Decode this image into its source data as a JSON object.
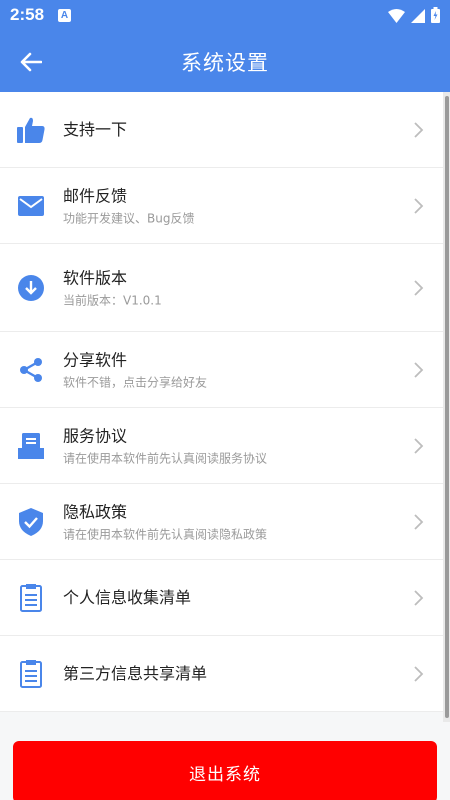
{
  "status_bar": {
    "time": "2:58",
    "badge": "A"
  },
  "app_bar": {
    "title": "系统设置"
  },
  "colors": {
    "primary": "#4a86ea",
    "danger": "#ff0000",
    "chevron": "#bdbdbd"
  },
  "settings": [
    {
      "title": "支持一下",
      "subtitle": "",
      "icon": "thumbs-up-icon"
    },
    {
      "title": "邮件反馈",
      "subtitle": "功能开发建议、Bug反馈",
      "icon": "mail-icon"
    },
    {
      "title": "软件版本",
      "subtitle": "当前版本：V1.0.1",
      "icon": "download-circle-icon"
    },
    {
      "title": "分享软件",
      "subtitle": "软件不错，点击分享给好友",
      "icon": "share-icon"
    },
    {
      "title": "服务协议",
      "subtitle": "请在使用本软件前先认真阅读服务协议",
      "icon": "document-tray-icon"
    },
    {
      "title": "隐私政策",
      "subtitle": "请在使用本软件前先认真阅读隐私政策",
      "icon": "shield-check-icon"
    },
    {
      "title": "个人信息收集清单",
      "subtitle": "",
      "icon": "clipboard-list-icon"
    },
    {
      "title": "第三方信息共享清单",
      "subtitle": "",
      "icon": "clipboard-list-icon"
    }
  ],
  "logout_label": "退出系统"
}
